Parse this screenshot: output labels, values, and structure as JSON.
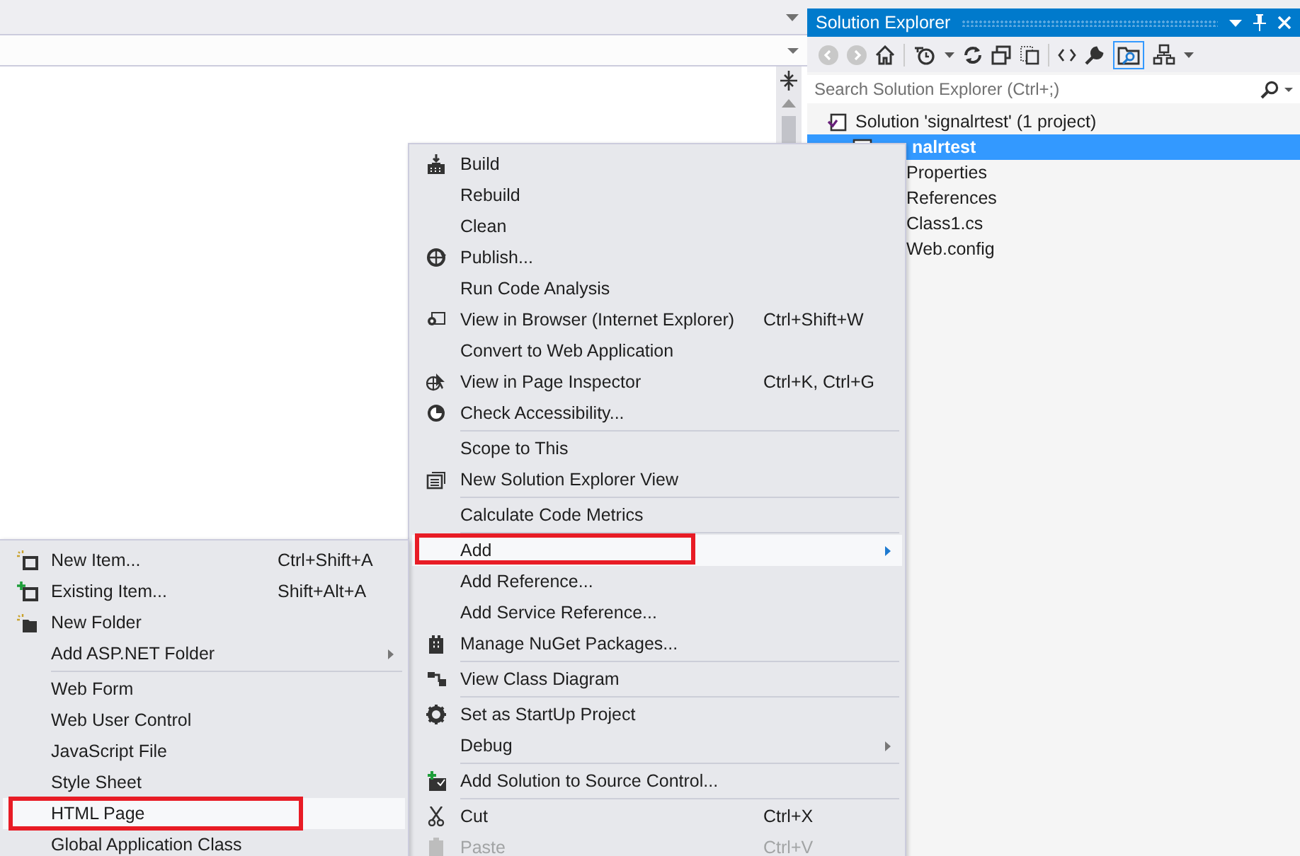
{
  "solution_explorer": {
    "title": "Solution Explorer",
    "search": {
      "placeholder": "Search Solution Explorer (Ctrl+;)"
    },
    "tree": [
      {
        "label": "Solution 'signalrtest' (1 project)",
        "selected": false,
        "children": [
          {
            "label": "nalrtest",
            "selected": true,
            "children": [
              {
                "label": "Properties",
                "selected": false
              },
              {
                "label": "References",
                "selected": false
              },
              {
                "label": "Class1.cs",
                "selected": false
              },
              {
                "label": "Web.config",
                "selected": false
              }
            ]
          }
        ]
      }
    ]
  },
  "context_menu": {
    "items": [
      {
        "kind": "item",
        "label": "Build",
        "highlighted": false
      },
      {
        "kind": "item",
        "label": "Rebuild",
        "highlighted": false
      },
      {
        "kind": "item",
        "label": "Clean",
        "highlighted": false
      },
      {
        "kind": "item",
        "label": "Publish...",
        "highlighted": false
      },
      {
        "kind": "item",
        "label": "Run Code Analysis",
        "highlighted": false
      },
      {
        "kind": "item",
        "label": "View in Browser (Internet Explorer)",
        "shortcut": "Ctrl+Shift+W",
        "highlighted": false
      },
      {
        "kind": "item",
        "label": "Convert to Web Application",
        "highlighted": false
      },
      {
        "kind": "item",
        "label": "View in Page Inspector",
        "shortcut": "Ctrl+K, Ctrl+G",
        "highlighted": false
      },
      {
        "kind": "item",
        "label": "Check Accessibility...",
        "highlighted": false
      },
      {
        "kind": "separator"
      },
      {
        "kind": "item",
        "label": "Scope to This",
        "highlighted": false
      },
      {
        "kind": "item",
        "label": "New Solution Explorer View",
        "highlighted": false
      },
      {
        "kind": "separator"
      },
      {
        "kind": "item",
        "label": "Calculate Code Metrics",
        "highlighted": false
      },
      {
        "kind": "separator"
      },
      {
        "kind": "submenu",
        "label": "Add",
        "highlighted": true,
        "annotated": true
      },
      {
        "kind": "item",
        "label": "Add Reference...",
        "highlighted": false
      },
      {
        "kind": "item",
        "label": "Add Service Reference...",
        "highlighted": false
      },
      {
        "kind": "item",
        "label": "Manage NuGet Packages...",
        "highlighted": false
      },
      {
        "kind": "separator"
      },
      {
        "kind": "item",
        "label": "View Class Diagram",
        "highlighted": false
      },
      {
        "kind": "separator"
      },
      {
        "kind": "item",
        "label": "Set as StartUp Project",
        "highlighted": false
      },
      {
        "kind": "submenu",
        "label": "Debug",
        "highlighted": false
      },
      {
        "kind": "separator"
      },
      {
        "kind": "item",
        "label": "Add Solution to Source Control...",
        "highlighted": false
      },
      {
        "kind": "separator"
      },
      {
        "kind": "item",
        "label": "Cut",
        "shortcut": "Ctrl+X",
        "highlighted": false
      },
      {
        "kind": "item",
        "label": "Paste",
        "shortcut": "Ctrl+V",
        "highlighted": false,
        "disabled": true
      }
    ]
  },
  "add_submenu": {
    "items": [
      {
        "kind": "item",
        "label": "New Item...",
        "shortcut": "Ctrl+Shift+A",
        "highlighted": false
      },
      {
        "kind": "item",
        "label": "Existing Item...",
        "shortcut": "Shift+Alt+A",
        "highlighted": false
      },
      {
        "kind": "item",
        "label": "New Folder",
        "highlighted": false
      },
      {
        "kind": "submenu",
        "label": "Add ASP.NET Folder",
        "highlighted": false
      },
      {
        "kind": "separator"
      },
      {
        "kind": "item",
        "label": "Web Form",
        "highlighted": false
      },
      {
        "kind": "item",
        "label": "Web User Control",
        "highlighted": false
      },
      {
        "kind": "item",
        "label": "JavaScript File",
        "highlighted": false
      },
      {
        "kind": "item",
        "label": "Style Sheet",
        "highlighted": false
      },
      {
        "kind": "item",
        "label": "HTML Page",
        "highlighted": true,
        "annotated": true
      },
      {
        "kind": "item",
        "label": "Global Application Class",
        "highlighted": false
      }
    ]
  }
}
